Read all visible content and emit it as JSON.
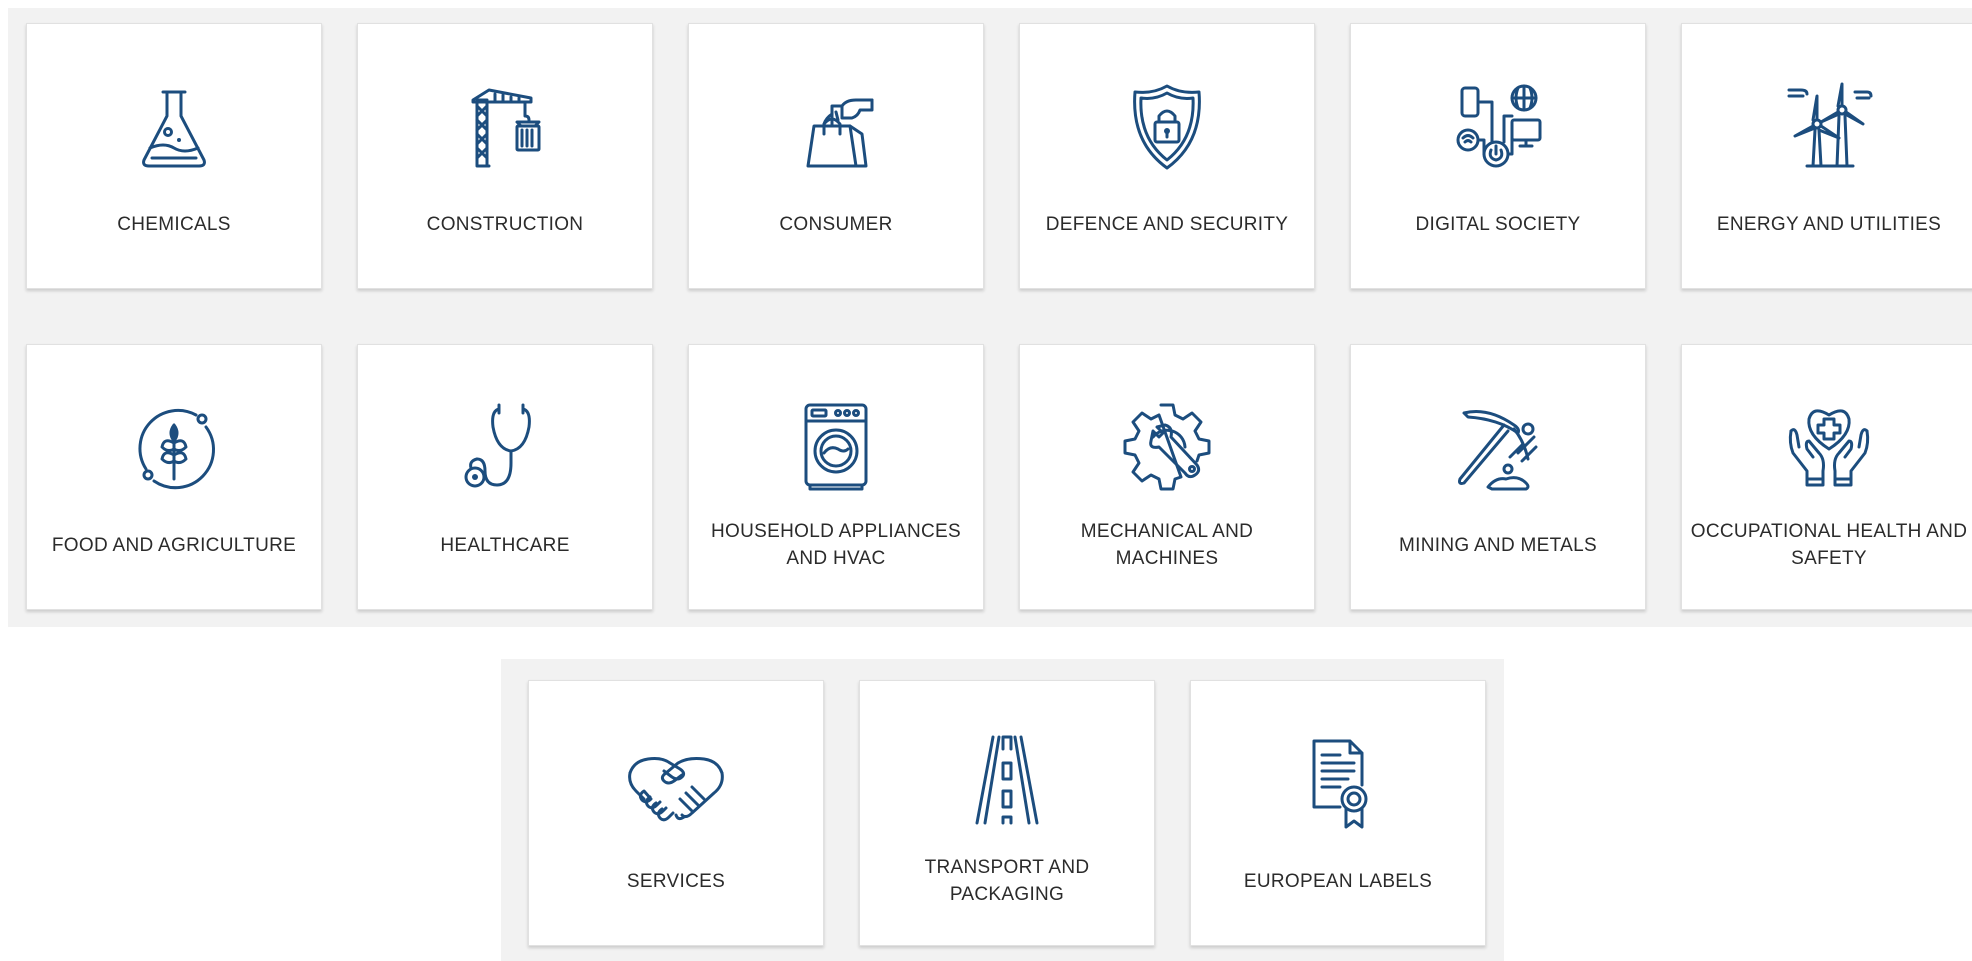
{
  "colors": {
    "icon": "#1c4d7e",
    "label": "#2b2b2b",
    "panel": "#f2f2f2",
    "card": "#ffffff"
  },
  "sectors": [
    {
      "label": "CHEMICALS",
      "icon": "flask-icon"
    },
    {
      "label": "CONSTRUCTION",
      "icon": "crane-icon"
    },
    {
      "label": "CONSUMER",
      "icon": "shopping-bag-icon"
    },
    {
      "label": "DEFENCE AND SECURITY",
      "icon": "shield-lock-icon"
    },
    {
      "label": "DIGITAL SOCIETY",
      "icon": "connected-devices-icon"
    },
    {
      "label": "ENERGY AND UTILITIES",
      "icon": "wind-turbine-icon"
    },
    {
      "label": "FOOD AND AGRICULTURE",
      "icon": "wheat-icon"
    },
    {
      "label": "HEALTHCARE",
      "icon": "stethoscope-icon"
    },
    {
      "label": "HOUSEHOLD APPLIANCES AND HVAC",
      "icon": "washing-machine-icon"
    },
    {
      "label": "MECHANICAL AND MACHINES",
      "icon": "gear-wrench-icon"
    },
    {
      "label": "MINING AND METALS",
      "icon": "pickaxe-icon"
    },
    {
      "label": "OCCUPATIONAL HEALTH AND SAFETY",
      "icon": "hands-heart-icon"
    }
  ],
  "extra_sectors": [
    {
      "label": "SERVICES",
      "icon": "handshake-icon"
    },
    {
      "label": "TRANSPORT AND PACKAGING",
      "icon": "road-icon"
    },
    {
      "label": "EUROPEAN LABELS",
      "icon": "certificate-icon"
    }
  ]
}
